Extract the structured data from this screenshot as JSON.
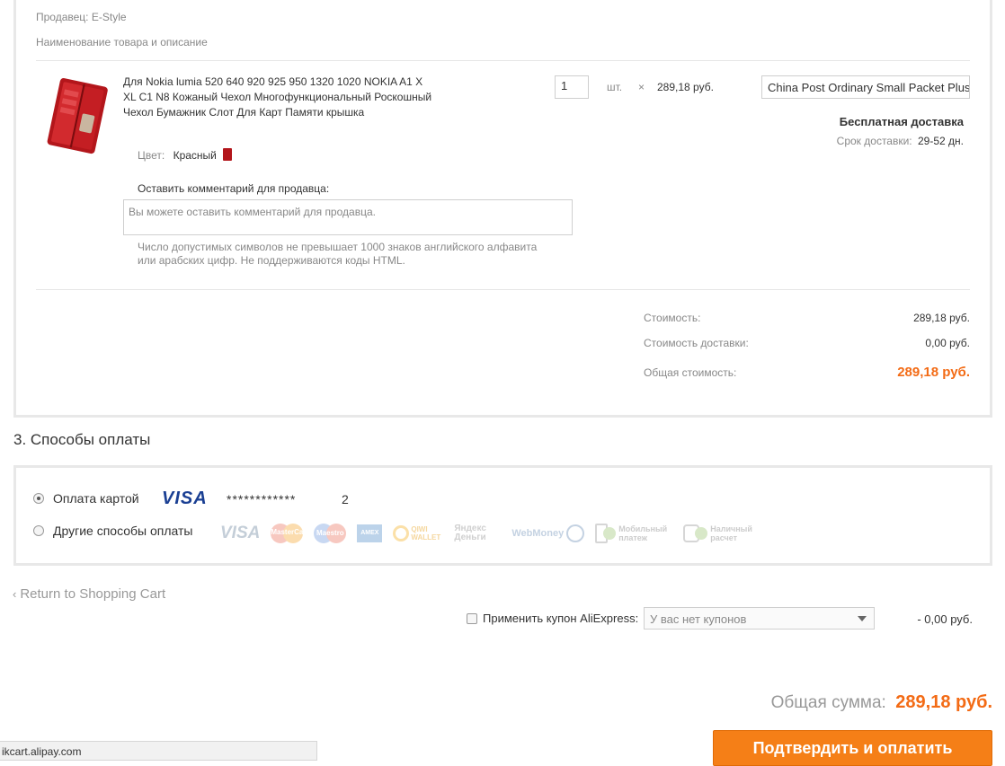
{
  "order": {
    "seller_label": "Продавец:",
    "seller_name": "E-Style",
    "items_header": "Наименование товара и описание",
    "product_title": "Для Nokia lumia 520 640 920 925 950 1320 1020 NOKIA A1 X XL C1 N8 Кожаный Чехол Многофункциональный Роскошный Чехол Бумажник Слот Для Карт Памяти крышка",
    "color_label": "Цвет:",
    "color_value": "Красный",
    "quantity": "1",
    "unit": "шт.",
    "times": "×",
    "unit_price": "289,18 руб.",
    "shipping_method": "China Post Ordinary Small Packet Plus",
    "free_shipping": "Бесплатная доставка",
    "delivery_label": "Срок доставки:",
    "delivery_value": "29-52 дн.",
    "comment_label": "Оставить комментарий для продавца:",
    "comment_placeholder": "Вы можете оставить комментарий для продавца.",
    "comment_hint": "Число допустимых символов не превышает 1000 знаков английского алфавита или арабских цифр. Не поддерживаются коды HTML.",
    "cost_label": "Стоимость:",
    "cost_value": "289,18 руб.",
    "shipping_cost_label": "Стоимость доставки:",
    "shipping_cost_value": "0,00 руб.",
    "total_label": "Общая стоимость:",
    "total_value": "289,18 руб."
  },
  "payment": {
    "section_title": "3. Способы оплаты",
    "card_label": "Оплата картой",
    "card_brand": "VISA",
    "card_mask": "************",
    "card_suffix": "2",
    "other_label": "Другие способы оплаты",
    "other_logos": [
      "VISA",
      "MasterCard",
      "Maestro",
      "AMEX",
      "QIWI WALLET",
      "Яндекс Деньги",
      "WebMoney",
      "Мобильный платеж",
      "Наличный расчет"
    ]
  },
  "footer": {
    "return_link": "Return to Shopping Cart",
    "coupon_label": "Применить купон AliExpress:",
    "coupon_select": "У вас нет купонов",
    "coupon_discount": "- 0,00 руб.",
    "grand_total_label": "Общая сумма:",
    "grand_total_value": "289,18 руб.",
    "confirm_button": "Подтвердить и оплатить",
    "status_url": "ikcart.alipay.com"
  },
  "colors": {
    "accent": "#f57f17",
    "price_orange": "#f36b15",
    "visa_blue": "#1a3f93"
  }
}
